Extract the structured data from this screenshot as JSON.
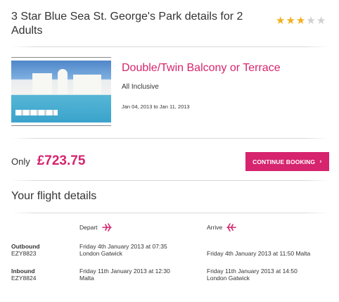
{
  "hotel": {
    "title": "3 Star Blue Sea St. George's Park details for 2 Adults",
    "rating": 3,
    "max_rating": 5,
    "colors": {
      "star_on": "#f2b01e",
      "star_off": "#d0d0d0"
    }
  },
  "room": {
    "name": "Double/Twin Balcony or Terrace",
    "board": "All Inclusive",
    "dates": "Jan 04, 2013 to Jan 11, 2013",
    "image_icon": "hotel-pool-photo"
  },
  "price": {
    "prefix": "Only",
    "amount": "£723.75"
  },
  "cta": {
    "label": "CONTINUE BOOKING",
    "icon": "chevron-right-icon"
  },
  "flights": {
    "heading": "Your flight details",
    "depart_label": "Depart",
    "arrive_label": "Arrive",
    "rows": [
      {
        "direction": "Outbound",
        "code": "EZY8823",
        "depart": "Friday 4th January 2013 at 07:35",
        "depart_place": "London Gatwick",
        "arrive": "",
        "arrive_place": "Friday 4th January 2013 at 11:50 Malta"
      },
      {
        "direction": "Inbound",
        "code": "EZY8824",
        "depart": "Friday 11th January 2013 at 12:30",
        "depart_place": "Malta",
        "arrive": "Friday 11th January 2013 at 14:50",
        "arrive_place": "London Gatwick"
      }
    ]
  },
  "colors": {
    "accent": "#d6246e",
    "text": "#333333"
  }
}
